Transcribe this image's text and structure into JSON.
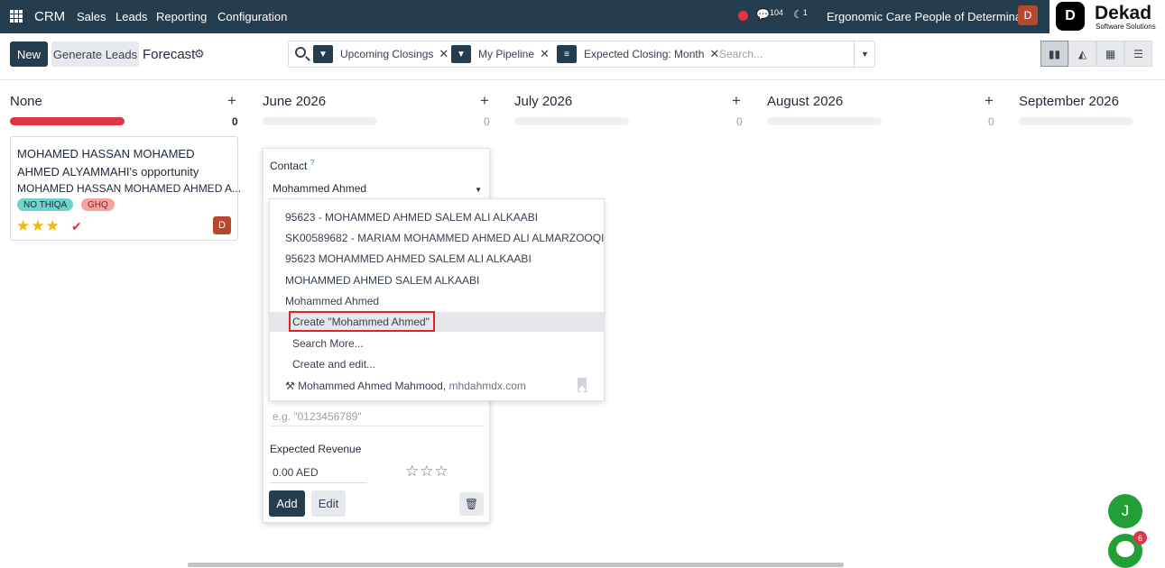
{
  "nav": {
    "app": "CRM",
    "menus": [
      "Sales",
      "Leads",
      "Reporting",
      "Configuration"
    ],
    "messages_count": "104",
    "activities_count": "1",
    "company": "Ergonomic Care People of Determina...",
    "user_initial": "D",
    "logo": {
      "mark": "D",
      "name": "Dekad",
      "tagline": "Software Solutions"
    }
  },
  "control": {
    "new_label": "New",
    "generate_label": "Generate Leads",
    "view_title": "Forecast"
  },
  "search": {
    "facets": [
      "Upcoming Closings",
      "My Pipeline",
      "Expected Closing: Month"
    ],
    "placeholder": "Search..."
  },
  "columns": [
    {
      "title": "None",
      "count": "0"
    },
    {
      "title": "June 2026",
      "count": "0"
    },
    {
      "title": "July 2026",
      "count": "0"
    },
    {
      "title": "August 2026",
      "count": "0"
    },
    {
      "title": "September 2026",
      "count": "0"
    }
  ],
  "card": {
    "title": "MOHAMED HASSAN MOHAMED AHMED ALYAMMAHI's opportunity",
    "subtitle": "MOHAMED HASSAN MOHAMED AHMED A...",
    "tags": [
      "NO THIQA",
      "GHQ"
    ],
    "priority_stars": 3,
    "assignee_initial": "D"
  },
  "quick_create": {
    "contact_label": "Contact",
    "contact_help": "?",
    "contact_value": "Mohammed Ahmed",
    "phone_placeholder": "e.g. \"0123456789\"",
    "revenue_label": "Expected Revenue",
    "revenue_value": "0.00 AED",
    "add_label": "Add",
    "edit_label": "Edit"
  },
  "dropdown": {
    "items": [
      "95623 - MOHAMMED AHMED SALEM ALI ALKAABI",
      "SK00589682 - MARIAM MOHAMMED AHMED ALI ALMARZOOQI",
      "95623 MOHAMMED AHMED SALEM ALI ALKAABI",
      "MOHAMMED AHMED SALEM ALKAABI",
      "Mohammed Ahmed"
    ],
    "create_label": "Create \"Mohammed Ahmed\"",
    "search_more": "Search More...",
    "create_edit": "Create and edit...",
    "suggestion_name": "Mohammed Ahmed Mahmood,",
    "suggestion_email": "mhdahmdx.com"
  },
  "bubbles": {
    "j_initial": "J",
    "bot_badge": "6"
  },
  "colors": {
    "navbar": "#243e4f",
    "primary": "#243e4f",
    "danger": "#dc3545",
    "star": "#f3b70f"
  }
}
